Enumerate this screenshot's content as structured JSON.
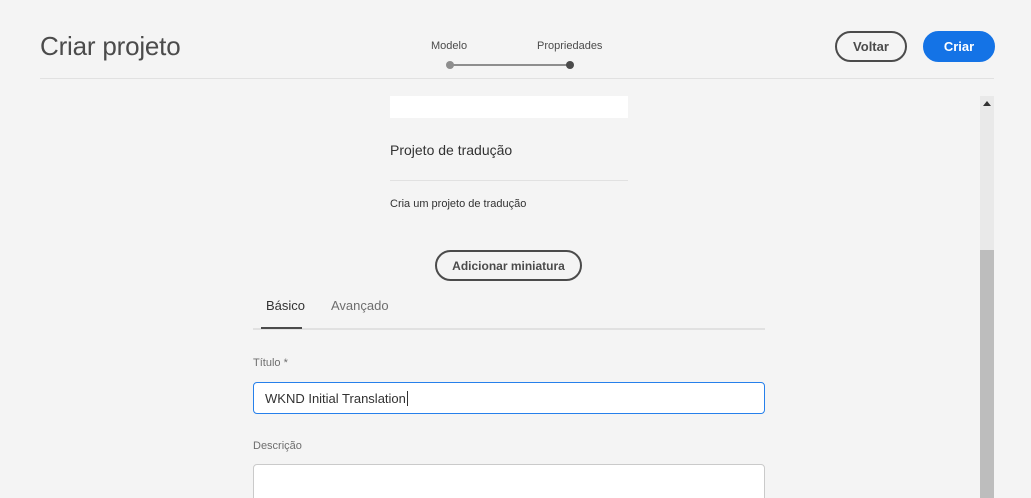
{
  "header": {
    "title": "Criar projeto",
    "steps": [
      {
        "label": "Modelo"
      },
      {
        "label": "Propriedades"
      }
    ],
    "back_label": "Voltar",
    "create_label": "Criar"
  },
  "template_card": {
    "title": "Projeto de tradução",
    "description": "Cria um projeto de tradução"
  },
  "thumbnail_button_label": "Adicionar miniatura",
  "tabs": [
    {
      "label": "Básico",
      "active": true
    },
    {
      "label": "Avançado",
      "active": false
    }
  ],
  "form": {
    "title_label": "Título *",
    "title_value": "WKND Initial Translation",
    "description_label": "Descrição",
    "description_value": ""
  },
  "colors": {
    "accent": "#1473e6",
    "background": "#f4f4f4",
    "focus_border": "#2680eb"
  }
}
